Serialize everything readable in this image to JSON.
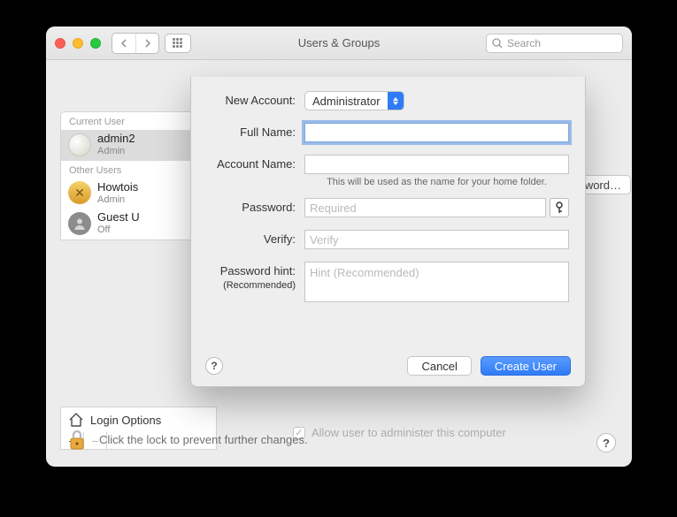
{
  "titlebar": {
    "title": "Users & Groups",
    "search_placeholder": "Search"
  },
  "sidebar": {
    "header_current": "Current User",
    "header_other": "Other Users",
    "items": [
      {
        "name": "admin2",
        "role": "Admin"
      },
      {
        "name": "Howtois",
        "role": "Admin"
      },
      {
        "name": "Guest U",
        "role": "Off"
      }
    ],
    "login_options": "Login Options"
  },
  "background": {
    "change_password_label": "sword…",
    "admin_checkbox_label": "Allow user to administer this computer",
    "lock_text": "Click the lock to prevent further changes."
  },
  "sheet": {
    "labels": {
      "new_account": "New Account:",
      "full_name": "Full Name:",
      "account_name": "Account Name:",
      "account_hint": "This will be used as the name for your home folder.",
      "password": "Password:",
      "password_placeholder": "Required",
      "verify": "Verify:",
      "verify_placeholder": "Verify",
      "hint": "Password hint:",
      "hint_sub": "(Recommended)",
      "hint_placeholder": "Hint (Recommended)"
    },
    "account_type": "Administrator",
    "buttons": {
      "cancel": "Cancel",
      "create": "Create User"
    }
  }
}
